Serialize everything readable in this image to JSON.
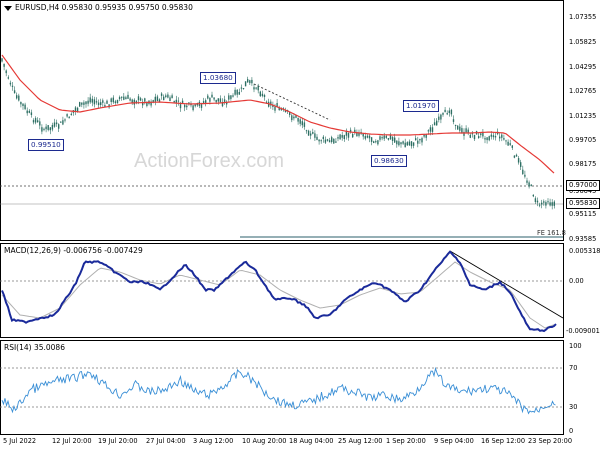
{
  "main": {
    "header": "EURUSD,H4  0.95830 0.95935 0.95750 0.95830",
    "y_ticks": [
      "1.07355",
      "1.05825",
      "1.04295",
      "1.02765",
      "1.01235",
      "0.99705",
      "0.98175",
      "0.96645",
      "0.95115",
      "0.93585"
    ],
    "annotations": [
      "1.03680",
      "0.99510",
      "1.01970",
      "0.98630"
    ],
    "price_tags": [
      "0.97000",
      "0.95830"
    ],
    "fib_label": "FE 161.8",
    "watermark": "ActionForex.com",
    "ma_color": "#e53935",
    "candle_color": "#2d6f63"
  },
  "macd": {
    "header": "MACD(12,26,9) -0.006756 -0.007429",
    "y_ticks": [
      "0.005318",
      "0.00",
      "-0.009001"
    ],
    "line_color": "#1a2a9a"
  },
  "rsi": {
    "header": "RSI(14) 35.0086",
    "y_ticks": [
      "100",
      "70",
      "30",
      "0"
    ],
    "line_color": "#3a8fd6"
  },
  "x_ticks": [
    "5 Jul 2022",
    "12 Jul 20:00",
    "19 Jul 20:00",
    "27 Jul 04:00",
    "3 Aug 12:00",
    "10 Aug 20:00",
    "18 Aug 04:00",
    "25 Aug 12:00",
    "1 Sep 20:00",
    "9 Sep 04:00",
    "16 Sep 12:00",
    "23 Sep 20:00"
  ]
}
